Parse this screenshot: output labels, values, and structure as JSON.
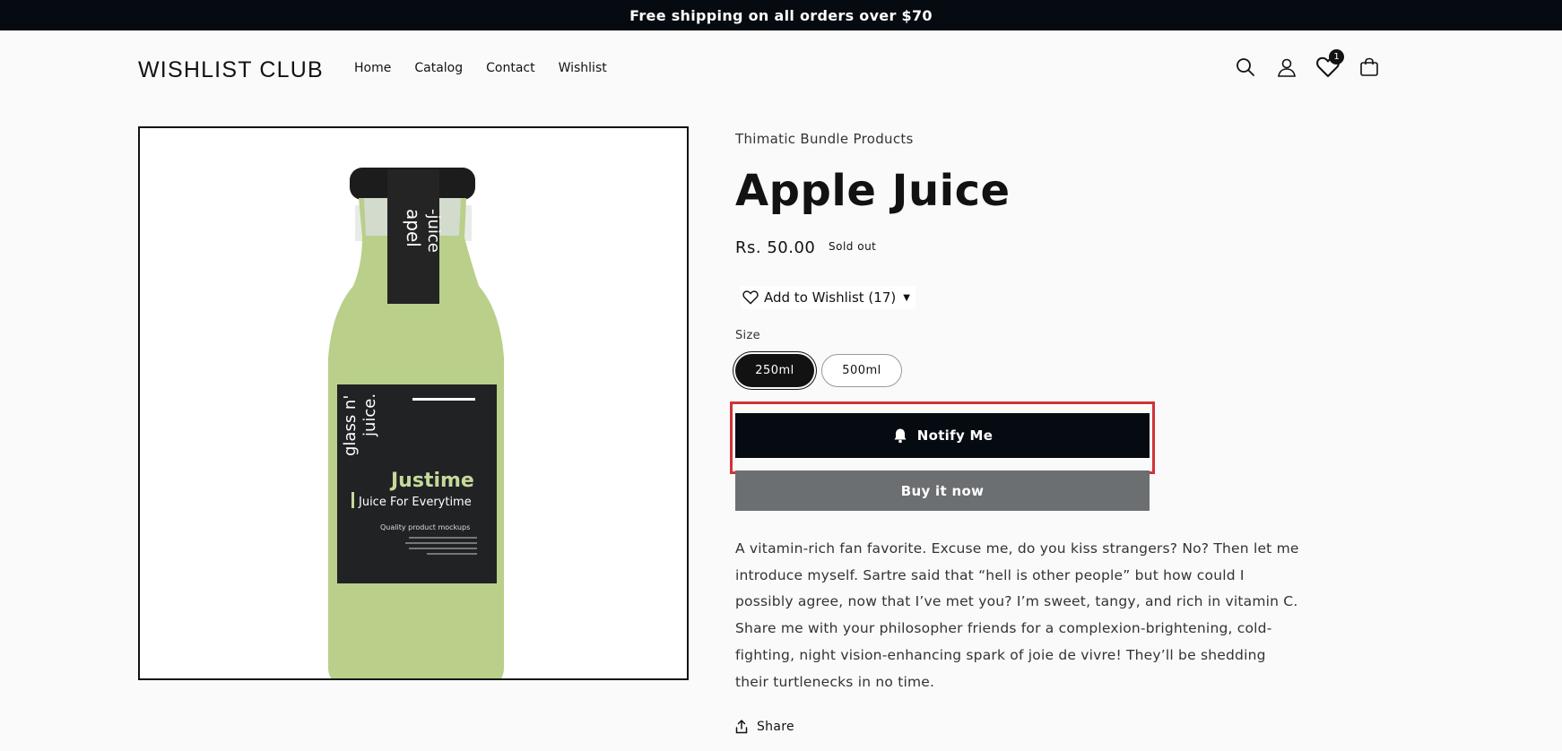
{
  "announcement": "Free shipping on all orders over $70",
  "header": {
    "logo": "WISHLIST CLUB",
    "nav": [
      "Home",
      "Catalog",
      "Contact",
      "Wishlist"
    ],
    "wishlist_count": "1"
  },
  "product": {
    "image_alt": "Apple juice bottle",
    "label": {
      "cap_text": "apel\n-juice",
      "brand": "glass n' juice.",
      "name": "Justime",
      "tagline": "Juice For Everytime",
      "small": "Quality product mockups"
    },
    "vendor": "Thimatic Bundle Products",
    "title": "Apple Juice",
    "price": "Rs. 50.00",
    "badge": "Sold out",
    "wishlist_button": "Add to Wishlist (17)",
    "size_label": "Size",
    "sizes": [
      "250ml",
      "500ml"
    ],
    "selected_size": "250ml",
    "notify_button": "Notify Me",
    "buy_button": "Buy it now",
    "description": "A vitamin-rich fan favorite. Excuse me, do you kiss strangers? No? Then let me introduce myself. Sartre said that “hell is other people” but how could I possibly agree, now that I’ve met you? I’m sweet, tangy, and rich in vitamin C. Share me with your philosopher friends for a complexion-brightening, cold-fighting, night vision-enhancing spark of joie de vivre! They’ll be shedding their turtlenecks in no time.",
    "share": "Share"
  },
  "colors": {
    "dark": "#060b11",
    "highlight": "#d0333a",
    "juice": "#b9cf8a",
    "buy_button": "#6c6f72"
  }
}
